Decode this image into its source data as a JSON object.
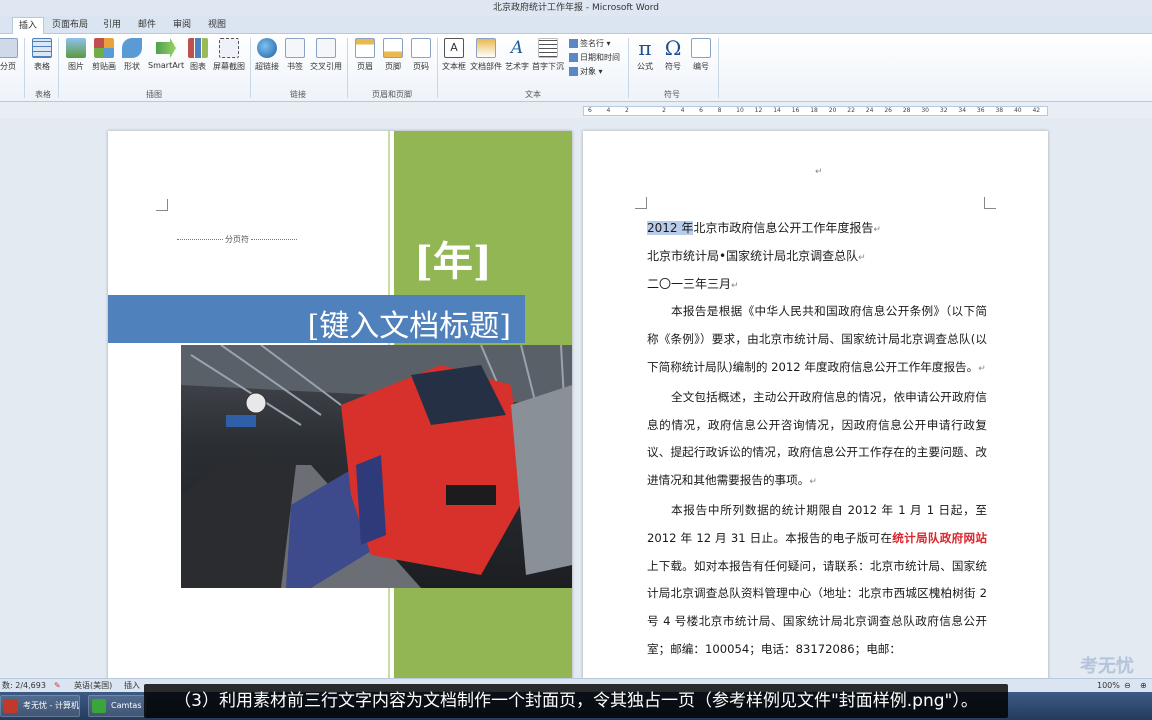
{
  "window": {
    "title": "北京政府统计工作年报 - Microsoft Word"
  },
  "tabs": [
    {
      "label": "插入",
      "active": true
    },
    {
      "label": "页面布局"
    },
    {
      "label": "引用"
    },
    {
      "label": "邮件"
    },
    {
      "label": "审阅"
    },
    {
      "label": "视图"
    }
  ],
  "ribbon": {
    "buttons": [
      {
        "label": "分页",
        "icon": "page-break-icon"
      },
      {
        "label": "表格",
        "icon": "table-icon"
      },
      {
        "label": "图片",
        "icon": "picture-icon"
      },
      {
        "label": "剪贴画",
        "icon": "clipart-icon"
      },
      {
        "label": "形状",
        "icon": "shapes-icon"
      },
      {
        "label": "SmartArt",
        "icon": "smartart-icon"
      },
      {
        "label": "图表",
        "icon": "chart-icon"
      },
      {
        "label": "屏幕截图",
        "icon": "screenshot-icon"
      },
      {
        "label": "超链接",
        "icon": "hyperlink-icon"
      },
      {
        "label": "书签",
        "icon": "bookmark-icon"
      },
      {
        "label": "交叉引用",
        "icon": "cross-reference-icon"
      },
      {
        "label": "页眉",
        "icon": "header-icon"
      },
      {
        "label": "页脚",
        "icon": "footer-icon"
      },
      {
        "label": "页码",
        "icon": "page-number-icon"
      },
      {
        "label": "文本框",
        "icon": "textbox-icon"
      },
      {
        "label": "文档部件",
        "icon": "quickparts-icon"
      },
      {
        "label": "艺术字",
        "icon": "wordart-icon"
      },
      {
        "label": "首字下沉",
        "icon": "dropcap-icon"
      },
      {
        "label": "公式",
        "icon": "equation-icon"
      },
      {
        "label": "符号",
        "icon": "symbol-icon"
      },
      {
        "label": "编号",
        "icon": "number-icon"
      }
    ],
    "small_items": {
      "signature": "签名行",
      "datetime": "日期和时间",
      "object": "对象"
    },
    "groups": {
      "tables": "表格",
      "illustrations": "插图",
      "links": "链接",
      "header_footer": "页眉和页脚",
      "text": "文本",
      "symbols": "符号"
    },
    "symbol_glyphs": {
      "pi": "π",
      "omega": "Ω"
    }
  },
  "ruler": {
    "ticks": [
      "6",
      "4",
      "2",
      "",
      "2",
      "4",
      "6",
      "8",
      "10",
      "12",
      "14",
      "16",
      "18",
      "20",
      "22",
      "24",
      "26",
      "28",
      "30",
      "32",
      "34",
      "36",
      "38",
      "40",
      "42"
    ]
  },
  "cover": {
    "page_break_label": "分页符",
    "year_placeholder": "[年]",
    "title_placeholder": "[键入文档标题]"
  },
  "document": {
    "line1_highlight": "2012 年",
    "line1_rest": "北京市政府信息公开工作年度报告",
    "line2": "北京市统计局•国家统计局北京调查总队",
    "line3": "二〇一三年三月",
    "para1": "本报告是根据《中华人民共和国政府信息公开条例》（以下简称《条例》）要求，由北京市统计局、国家统计局北京调查总队(以下简称统计局队)编制的 2012 年度政府信息公开工作年度报告。",
    "para2": "全文包括概述，主动公开政府信息的情况，依申请公开政府信息的情况，政府信息公开咨询情况，因政府信息公开申请行政复议、提起行政诉讼的情况，政府信息公开工作存在的主要问题、改进情况和其他需要报告的事项。",
    "para3_a": "本报告中所列数据的统计期限自 2012 年 1 月 1 日起，至 2012 年 12 月 31 日止。本报告的电子版可在",
    "para3_link": "统计局队政府网站",
    "para3_b": "上下载。如对本报告有任何疑问，请联系：北京市统计局、国家统计局北京调查总队资料管理中心（地址：北京市西城区槐柏树街 2 号 4 号楼北京市统计局、国家统计局北京调查总队政府信息公开室；邮编：100054；电话：83172086；电邮："
  },
  "status": {
    "page_words": "数: 2/4,693",
    "language": "英语(美国)",
    "mode": "插入",
    "zoom": "100%"
  },
  "taskbar": {
    "items": [
      "考无忧 - 计算机...",
      "Camtas"
    ]
  },
  "caption": "（3）利用素材前三行文字内容为文档制作一个封面页，令其独占一页（参考样例见文件\"封面样例.png\"）。",
  "watermark": "考无忧",
  "colors": {
    "accent_blue": "#4f81bd",
    "cover_green": "#93b655",
    "link_red": "#d8272d"
  }
}
